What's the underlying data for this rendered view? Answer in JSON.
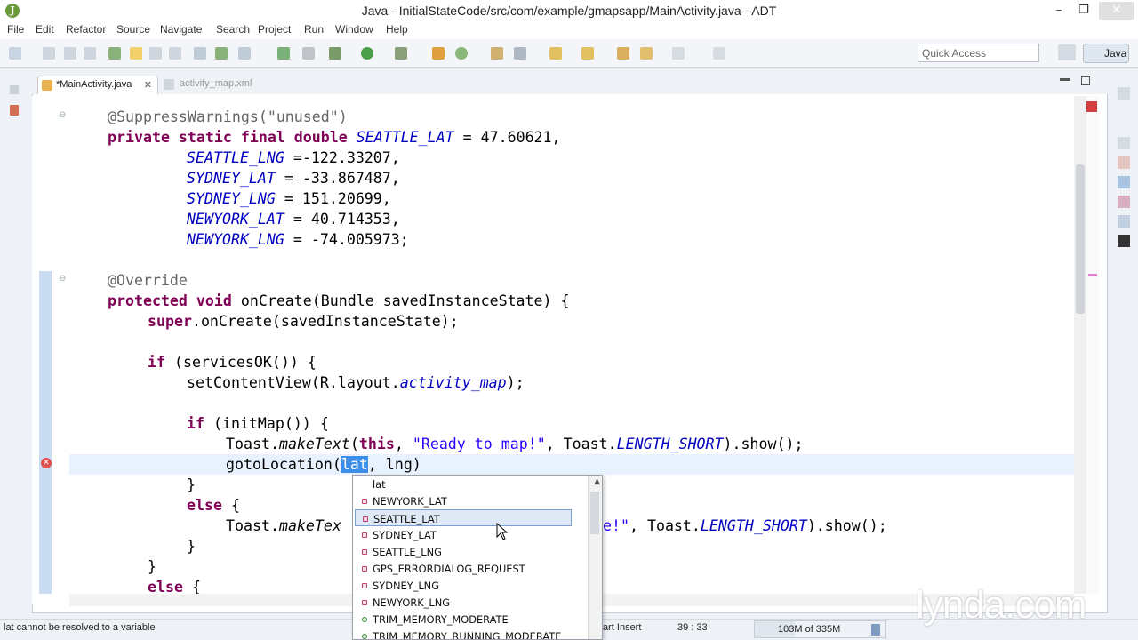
{
  "window": {
    "title": "Java - InitialStateCode/src/com/example/gmapsapp/MainActivity.java - ADT",
    "minimize": "–",
    "maximize": "❐",
    "close": "✕"
  },
  "menu": [
    "File",
    "Edit",
    "Refactor",
    "Source",
    "Navigate",
    "Search",
    "Project",
    "Run",
    "Window",
    "Help"
  ],
  "toolbar": {
    "quick_access_placeholder": "Quick Access",
    "perspective_label": "Java"
  },
  "tabs": {
    "active": "*MainActivity.java",
    "inactive": "activity_map.xml",
    "close_glyph": "✕"
  },
  "code": {
    "l1": "@SuppressWarnings(\"unused\")",
    "l2_kw": "private static final double ",
    "l2_const": "SEATTLE_LAT",
    "l2_rest": " = 47.60621,",
    "l3_const": "SEATTLE_LNG",
    "l3_rest": " =-122.33207,",
    "l4_const": "SYDNEY_LAT",
    "l4_rest": " = -33.867487,",
    "l5_const": "SYDNEY_LNG",
    "l5_rest": " = 151.20699,",
    "l6_const": "NEWYORK_LAT",
    "l6_rest": " = 40.714353,",
    "l7_const": "NEWYORK_LNG",
    "l7_rest": " = -74.005973;",
    "l8": "@Override",
    "l9_kw": "protected void ",
    "l9_rest": "onCreate(Bundle savedInstanceState) {",
    "l10_kw": "super",
    "l10_rest": ".onCreate(savedInstanceState);",
    "l11_kw": "if ",
    "l11_rest": "(servicesOK()) {",
    "l12_a": "setContentView(R.layout.",
    "l12_field": "activity_map",
    "l12_b": ");",
    "l13_kw": "if ",
    "l13_rest": "(initMap()) {",
    "l14_a": "Toast.",
    "l14_method": "makeText",
    "l14_b": "(",
    "l14_kw": "this",
    "l14_c": ", ",
    "l14_str": "\"Ready to map!\"",
    "l14_d": ", Toast.",
    "l14_const": "LENGTH_SHORT",
    "l14_e": ").show();",
    "l15_a": "gotoLocation(",
    "l15_sel": "lat",
    "l15_b": ", lng)",
    "l16": "}",
    "l17_kw": "else",
    "l17_rest": " {",
    "l18_a": "Toast.",
    "l18_method": "makeTex",
    "l18_str": "e!\"",
    "l18_d": ", Toast.",
    "l18_const": "LENGTH_SHORT",
    "l18_e": ").show();",
    "l19": "}",
    "l20": "}",
    "l21_kw": "else",
    "l21_rest": " {"
  },
  "autocomplete": {
    "header": "lat",
    "items": [
      {
        "label": "NEWYORK_LAT",
        "kind": "field"
      },
      {
        "label": "SEATTLE_LAT",
        "kind": "field",
        "selected": true
      },
      {
        "label": "SYDNEY_LAT",
        "kind": "field"
      },
      {
        "label": "SEATTLE_LNG",
        "kind": "field"
      },
      {
        "label": "GPS_ERRORDIALOG_REQUEST",
        "kind": "field"
      },
      {
        "label": "SYDNEY_LNG",
        "kind": "field"
      },
      {
        "label": "NEWYORK_LNG",
        "kind": "field"
      },
      {
        "label": "TRIM_MEMORY_MODERATE",
        "kind": "constant"
      },
      {
        "label": "TRIM_MEMORY_RUNNING_MODERATE",
        "kind": "constant"
      }
    ]
  },
  "status": {
    "message": "lat cannot be resolved to a variable",
    "mode": "Smart Insert",
    "mode_visible": "art Insert",
    "position": "39 : 33",
    "heap": "103M of 335M",
    "heap_fraction": 0.31
  },
  "watermark": "lynda.com",
  "colors": {
    "keyword": "#7f0055",
    "constant": "#0000c0",
    "string": "#2a00ff",
    "annotation": "#646464",
    "selection": "#3d8ee8",
    "current_line": "#e8f2fe"
  }
}
